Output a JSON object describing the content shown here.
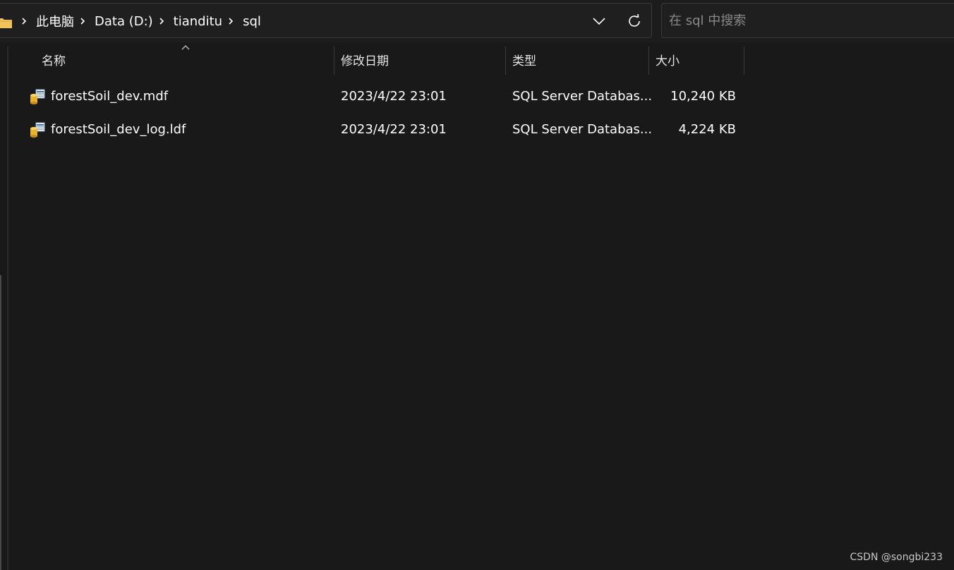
{
  "breadcrumb": [
    "此电脑",
    "Data (D:)",
    "tianditu",
    "sql"
  ],
  "search": {
    "placeholder": "在 sql 中搜索"
  },
  "columns": {
    "name": "名称",
    "modified": "修改日期",
    "type": "类型",
    "size": "大小"
  },
  "files": [
    {
      "name": "forestSoil_dev.mdf",
      "modified": "2023/4/22 23:01",
      "type": "SQL Server Databas...",
      "size": "10,240 KB",
      "icon": "sql-database-file-icon"
    },
    {
      "name": "forestSoil_dev_log.ldf",
      "modified": "2023/4/22 23:01",
      "type": "SQL Server Databas...",
      "size": "4,224 KB",
      "icon": "sql-database-file-icon"
    }
  ],
  "watermark": "CSDN @songbi233",
  "colors": {
    "background": "#191919",
    "text": "#ffffff",
    "folder": "#f2c25b"
  }
}
